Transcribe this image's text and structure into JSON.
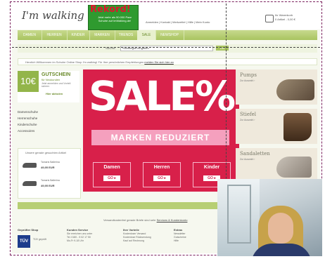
{
  "header": {
    "logo": "I'm walking",
    "promo_heading": "Rekord!",
    "promo_text": "Jetzt mehr als 50.000 Paar Schuhe auf ImWalking.de!",
    "top_links": [
      "Anmelden",
      "Kontakt",
      "Merkzettel",
      "Hilfe",
      "Mein Konto"
    ],
    "cart_title": "Ihr Warenkorb",
    "cart_value": "0 Artikel - 0,00 €"
  },
  "nav": {
    "items": [
      "DAMEN",
      "HERREN",
      "KINDER",
      "MARKEN",
      "TRENDS",
      "SALE",
      "NEWSHOP"
    ],
    "active_index": 5
  },
  "search": {
    "label": "SUCHE",
    "placeholder": "Suchbegriff eingeben",
    "button": "Los"
  },
  "welcome": {
    "text": "Herzlich Willkommen im Schuhe Online Shop I'm walking! Für Ihre persönlichen Empfehlungen",
    "link": "melden Sie sich hier an"
  },
  "voucher": {
    "amount": "10€",
    "title": "GUTSCHEIN",
    "subtitle": "für Neukunden",
    "desc": "Jetzt anmelden und Vorteil sichern",
    "link": "Hier abholen"
  },
  "sidebar": {
    "items": [
      "Damenschuhe",
      "Herrenschuhe",
      "Kinderschuhe",
      "Accessoires"
    ]
  },
  "products_box": {
    "title": "Unsere gerade gesuchten Artikel",
    "items": [
      {
        "name": "Tamaris Ballerina",
        "price": "49,95 EUR"
      },
      {
        "name": "Tamaris Ballerina",
        "price": "49,95 EUR"
      }
    ]
  },
  "sale_banner": {
    "headline": "SALE%",
    "band": "MARKEN REDUZIERT",
    "categories": [
      "Damen",
      "Herren",
      "Kinder"
    ],
    "cta": "GO ▸"
  },
  "right_categories": [
    {
      "title": "Pumps",
      "link": "Zur Auswahl ›"
    },
    {
      "title": "Stiefel",
      "link": "Zur Auswahl ›"
    },
    {
      "title": "Sandaletten",
      "link": "Zur Auswahl ›"
    }
  ],
  "footnote": {
    "text": "Versandkostenfrei gerade Briefe sind sehr",
    "link": "Services & Kundenkonto"
  },
  "footer": {
    "columns": [
      {
        "heading": "Geprüfter Shop",
        "items": [
          "TÜV geprüft"
        ]
      },
      {
        "heading": "Kunden Service",
        "items": [
          "Sie erreichen uns unter",
          "Tel. 0180 - 5 02 17 50",
          "Mo-Fr 9-18 Uhr"
        ]
      },
      {
        "heading": "Ihre Vorteile",
        "items": [
          "Kostenloser Versand",
          "Kostenlose Rücksendung",
          "Kauf auf Rechnung"
        ]
      },
      {
        "heading": "Extras",
        "items": [
          "Newsletter",
          "Gutscheine",
          "Hilfe"
        ]
      }
    ],
    "tuv": "TÜV"
  }
}
